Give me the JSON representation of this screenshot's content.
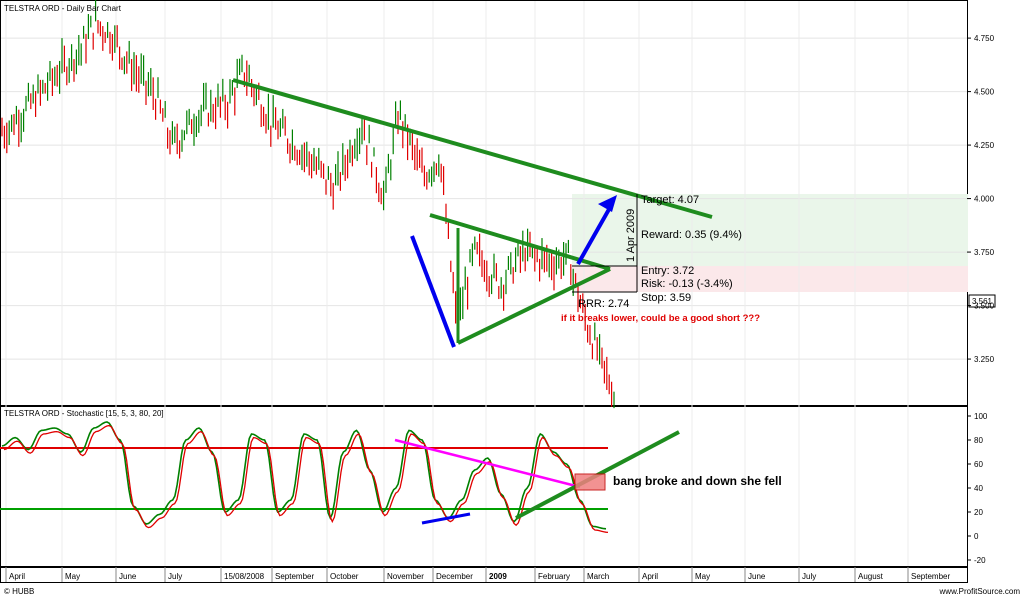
{
  "header": {
    "price_title": "TELSTRA ORD - Daily Bar Chart",
    "stoch_title": "TELSTRA ORD - Stochastic [15, 5, 3, 80, 20]",
    "footer_left": "© HUBB",
    "footer_right": "www.ProfitSource.com"
  },
  "annotations": {
    "target": "Target: 4.07",
    "reward": "Reward: 0.35 (9.4%)",
    "entry": "Entry: 3.72",
    "risk": "Risk: -0.13 (-3.4%)",
    "stop": "Stop: 3.59",
    "rr": "RRR: 2.74",
    "date_vertical": "1 Apr 2009",
    "note_red": "if it breaks lower, could be a good short ???",
    "note_stoch": "bang broke and down she fell",
    "last_price": "3.561"
  },
  "colors": {
    "up_bar": "#008000",
    "down_bar": "#e00000",
    "trendline": "#1e8c1e",
    "blue_line": "#0000ee",
    "magenta_line": "#ff00ff",
    "stoch_upper": "#e00000",
    "stoch_lower": "#00a000"
  },
  "chart_data": [
    {
      "type": "bar",
      "title": "TELSTRA ORD - Daily Bar Chart",
      "x_ticks": [
        "April",
        "May",
        "June",
        "July",
        "15/08/2008",
        "September",
        "October",
        "November",
        "December",
        "2009",
        "February",
        "March",
        "April",
        "May",
        "June",
        "July",
        "August",
        "September"
      ],
      "y_ticks": [
        3.25,
        3.5,
        3.75,
        4.0,
        4.25,
        4.5,
        4.75
      ],
      "ylim": [
        3.04,
        4.9
      ],
      "last_price": 3.561,
      "trade_levels": {
        "target": 4.07,
        "entry": 3.72,
        "stop": 3.59
      },
      "close_series": [
        {
          "date": "2008-04-01",
          "value": 4.32
        },
        {
          "date": "2008-04-15",
          "value": 4.45
        },
        {
          "date": "2008-04-30",
          "value": 4.6
        },
        {
          "date": "2008-05-12",
          "value": 4.7
        },
        {
          "date": "2008-05-20",
          "value": 4.82
        },
        {
          "date": "2008-05-28",
          "value": 4.78
        },
        {
          "date": "2008-06-10",
          "value": 4.62
        },
        {
          "date": "2008-06-25",
          "value": 4.48
        },
        {
          "date": "2008-07-05",
          "value": 4.25
        },
        {
          "date": "2008-07-20",
          "value": 4.4
        },
        {
          "date": "2008-08-05",
          "value": 4.45
        },
        {
          "date": "2008-08-15",
          "value": 4.6
        },
        {
          "date": "2008-09-01",
          "value": 4.35
        },
        {
          "date": "2008-09-20",
          "value": 4.2
        },
        {
          "date": "2008-10-05",
          "value": 4.05
        },
        {
          "date": "2008-10-20",
          "value": 4.35
        },
        {
          "date": "2008-11-01",
          "value": 4.0
        },
        {
          "date": "2008-11-10",
          "value": 4.4
        },
        {
          "date": "2008-11-25",
          "value": 4.1
        },
        {
          "date": "2008-12-05",
          "value": 4.2
        },
        {
          "date": "2008-12-15",
          "value": 3.4
        },
        {
          "date": "2008-12-25",
          "value": 3.75
        },
        {
          "date": "2009-01-10",
          "value": 3.6
        },
        {
          "date": "2009-01-25",
          "value": 3.75
        },
        {
          "date": "2009-02-10",
          "value": 3.7
        },
        {
          "date": "2009-02-20",
          "value": 3.72
        },
        {
          "date": "2009-03-01",
          "value": 3.45
        },
        {
          "date": "2009-03-10",
          "value": 3.25
        },
        {
          "date": "2009-03-18",
          "value": 3.08
        }
      ]
    },
    {
      "type": "line",
      "title": "TELSTRA ORD - Stochastic [15, 5, 3, 80, 20]",
      "y_ticks": [
        -20,
        0,
        20,
        40,
        60,
        80,
        100
      ],
      "ylim": [
        -25,
        105
      ],
      "levels": [
        80,
        20
      ],
      "series": [
        {
          "values": [
            75,
            82,
            72,
            88,
            90,
            85,
            70,
            90,
            95,
            80,
            25,
            10,
            18,
            30,
            80,
            90,
            70,
            20,
            30,
            85,
            80,
            20,
            30,
            85,
            80,
            15,
            70,
            88,
            55,
            20,
            40,
            88,
            80,
            30,
            15,
            30,
            55,
            65,
            35,
            12,
            40,
            85,
            70,
            60,
            30,
            8,
            6
          ]
        }
      ]
    }
  ]
}
